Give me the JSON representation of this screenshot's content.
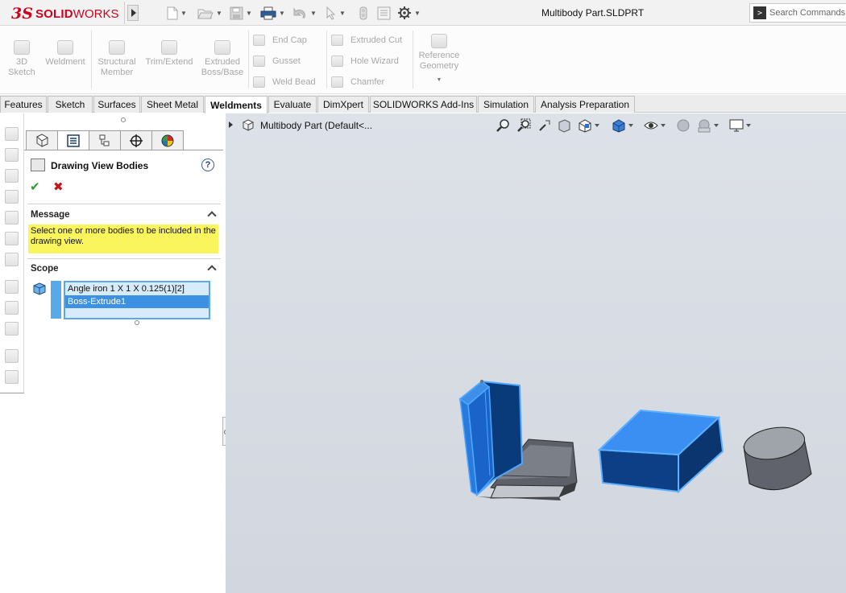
{
  "app": {
    "logo_prefix": "3S",
    "logo_bold": "SOLID",
    "logo_rest": "WORKS",
    "document_title": "Multibody Part.SLDPRT",
    "search_placeholder": "Search Commands"
  },
  "ribbon": {
    "buttons": [
      {
        "label": "3D\nSketch",
        "icon": "3d-sketch-icon"
      },
      {
        "label": "Weldment",
        "icon": "weldment-icon"
      },
      {
        "label": "Structural\nMember",
        "icon": "structural-member-icon"
      },
      {
        "label": "Trim/Extend",
        "icon": "trim-extend-icon"
      },
      {
        "label": "Extruded\nBoss/Base",
        "icon": "extruded-boss-icon"
      }
    ],
    "stack1": [
      "End Cap",
      "Gusset",
      "Weld Bead"
    ],
    "stack2": [
      "Extruded Cut",
      "Hole Wizard",
      "Chamfer"
    ],
    "reference_geometry": "Reference\nGeometry"
  },
  "tabs": [
    {
      "label": "Features",
      "active": false
    },
    {
      "label": "Sketch",
      "active": false
    },
    {
      "label": "Surfaces",
      "active": false
    },
    {
      "label": "Sheet Metal",
      "active": false
    },
    {
      "label": "Weldments",
      "active": true
    },
    {
      "label": "Evaluate",
      "active": false
    },
    {
      "label": "DimXpert",
      "active": false
    },
    {
      "label": "SOLIDWORKS Add-Ins",
      "active": false
    },
    {
      "label": "Simulation",
      "active": false
    },
    {
      "label": "Analysis Preparation",
      "active": false
    }
  ],
  "property_manager": {
    "title": "Drawing View Bodies",
    "help": "?",
    "ok": "✔",
    "cancel": "✖",
    "message_header": "Message",
    "message_text": "Select one or more bodies to be included in the drawing view.",
    "scope_header": "Scope",
    "scope_items": [
      {
        "label": "Angle iron 1 X 1 X 0.125(1)[2]",
        "selected": false
      },
      {
        "label": "Boss-Extrude1",
        "selected": true
      }
    ]
  },
  "viewport": {
    "tree_label": "Multibody Part  (Default<..."
  },
  "colors": {
    "accent": "#3d91e2",
    "message_bg": "#fbf55d",
    "viewport_bg": "#d6dae1",
    "selected_body": "#1f6fd6",
    "unselected_body": "#6b6e75"
  }
}
